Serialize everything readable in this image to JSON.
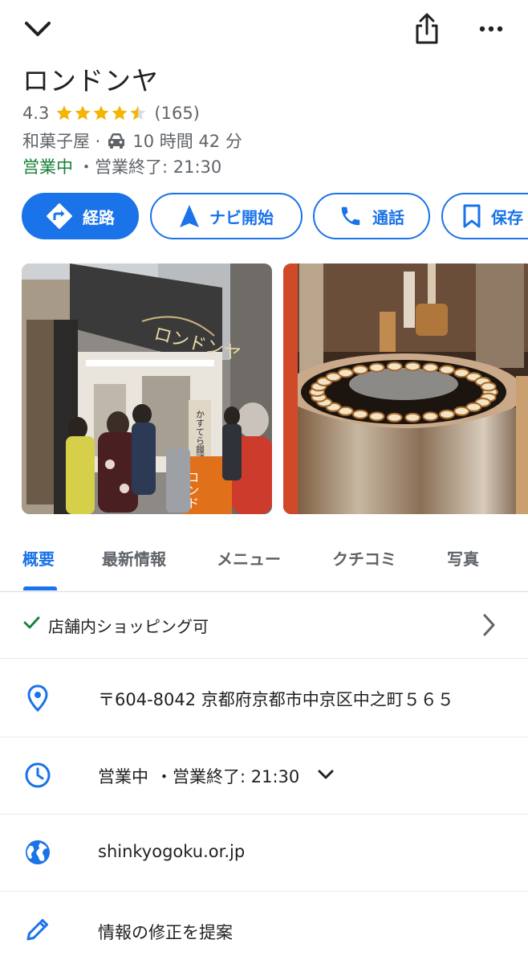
{
  "header": {
    "back_icon": "chevron-down-icon",
    "share_icon": "share-icon",
    "more_icon": "more-horizontal-icon"
  },
  "place": {
    "name": "ロンドンヤ",
    "rating": "4.3",
    "rating_value": 4.3,
    "review_count": "(165)",
    "category": "和菓子屋 ·",
    "travel_time": "10 時間 42 分",
    "status_open": "営業中",
    "status_close": "・営業終了: 21:30"
  },
  "actions": {
    "directions": "経路",
    "navigate": "ナビ開始",
    "call": "通話",
    "save": "保存"
  },
  "photos": {
    "storefront_sign": "ロンドンヤ",
    "storefront_banner": "かすてら饅頭",
    "storefront_panel": "ロンド"
  },
  "tabs": [
    "概要",
    "最新情報",
    "メニュー",
    "クチコミ",
    "写真"
  ],
  "details": {
    "shopping": "店舗内ショッピング可",
    "address": "〒604-8042 京都府京都市中京区中之町５６５",
    "hours_open": "営業中",
    "hours_close": "・営業終了: 21:30",
    "website": "shinkyogoku.or.jp",
    "suggest_edit": "情報の修正を提案"
  },
  "colors": {
    "accent": "#1a73e8",
    "open": "#188038",
    "star": "#f4b400"
  }
}
